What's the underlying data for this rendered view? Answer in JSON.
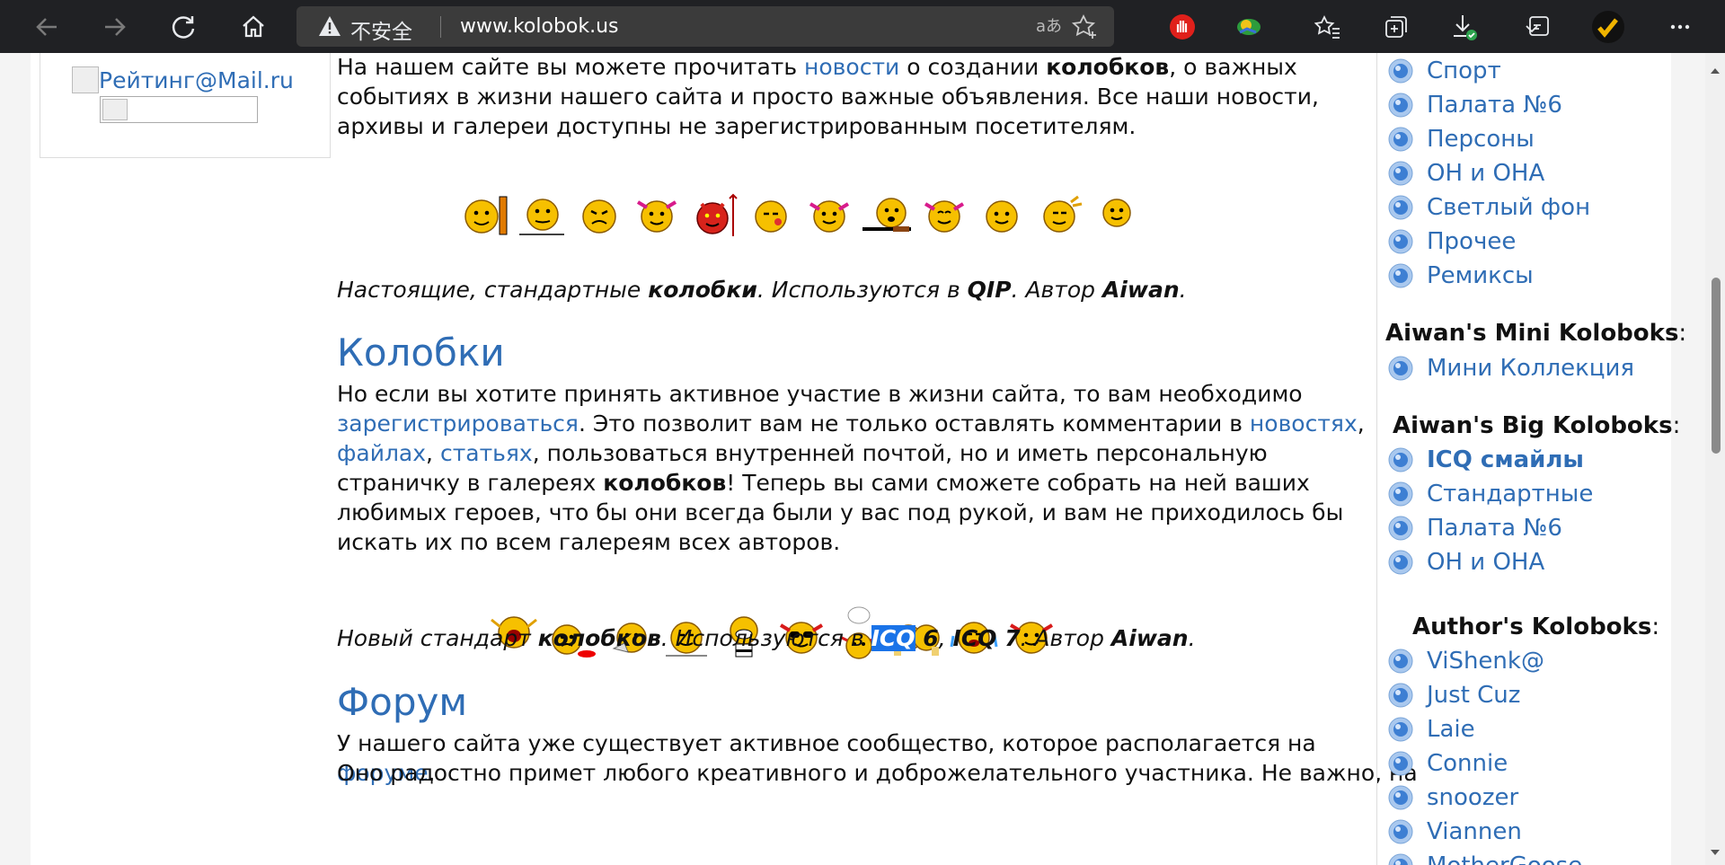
{
  "browser": {
    "security_label": "不安全",
    "url": "www.kolobok.us",
    "accent_warning": "#e8eaed"
  },
  "left": {
    "rating_alt": "Рейтинг@Mail.ru"
  },
  "main": {
    "intro": {
      "t1": "На нашем сайте вы можете прочитать ",
      "link_news": "новости",
      "t2": " о создании ",
      "b1": "колобков",
      "t3": ", о важных событиях в жизни нашего сайта и просто важные объявления. Все наши новости, архивы и галереи доступны не зарегистрированным посетителям."
    },
    "caption1": {
      "t1": "Настоящие, стандартные ",
      "b1": "колобки",
      "t2": ". Используются в ",
      "b2": "QIP",
      "t3": ". Автор ",
      "b3": "Aiwan",
      "t4": "."
    },
    "section_kolobki": {
      "title": "Колобки",
      "t1": "Но если вы хотите принять активное участие в жизни сайта, то вам необходимо ",
      "link_register": "зарегистрироваться",
      "t2": ". Это позволит вам не только оставлять комментарии в ",
      "link_news": "новостях",
      "t3": ", ",
      "link_files": "файлах",
      "t4": ", ",
      "link_articles": "статьях",
      "t5": ", пользоваться внутренней почтой, но и иметь персональную страничку в галереях ",
      "b1": "колобков",
      "t6": "! Теперь вы сами сможете собрать на ней ваших любимых героев, что бы они всегда были у вас под рукой, и вам не приходилось бы искать их по всем галереям всех авторов."
    },
    "caption2": {
      "t1": "Новый стандарт ",
      "b1": "колобков",
      "t2": ". Используются в ",
      "b2_hl": "ICQ",
      "b2_rest": " 6",
      "t3": ", ",
      "b3": "ICQ 7",
      "t4": ". Автор ",
      "b4": "Aiwan",
      "t5": "."
    },
    "section_forum": {
      "title": "Форум",
      "t1": "У нашего сайта уже существует активное сообщество, которое располагается на ",
      "link_forum": "форуме",
      "t2": ".",
      "t3": "Оно радостно примет любого креативного и доброжелательного участника. Не важно, на"
    }
  },
  "sidebar": {
    "top_items": [
      "Спорт",
      "Палата №6",
      "Персоны",
      "ОН и ОНА",
      "Светлый фон",
      "Прочее",
      "Ремиксы"
    ],
    "mini_title": "Aiwan's Mini Koloboks",
    "mini_items": [
      "Мини Коллекция"
    ],
    "big_title": "Aiwan's Big Koloboks",
    "big_items": [
      "ICQ смайлы",
      "Стандартные",
      "Палата №6",
      "ОН и ОНА"
    ],
    "author_title": "Author's Koloboks",
    "author_items": [
      "ViShenk@",
      "Just Cuz",
      "Laie",
      "Connie",
      "snoozer",
      "Viannen",
      "MotherGoose"
    ],
    "colon": ":"
  }
}
